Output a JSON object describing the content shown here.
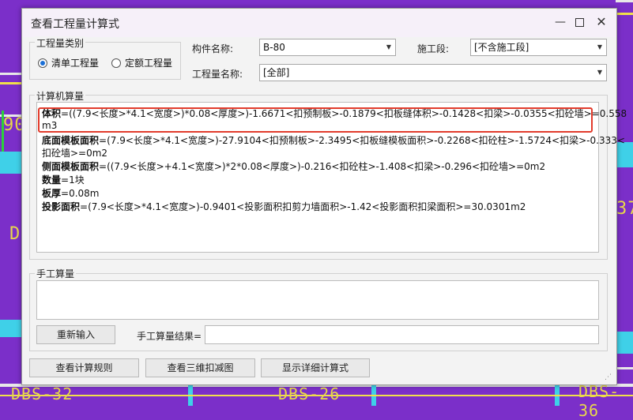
{
  "background": {
    "labels_bottom": [
      "DBS-32",
      "DBS-26",
      "DBS-36"
    ],
    "label_left": "90",
    "label_left2": "D",
    "label_right": "37"
  },
  "dialog": {
    "title": "查看工程量计算式",
    "controls": {
      "minimize": "—",
      "close": "✕"
    }
  },
  "quantity_type": {
    "group_label": "工程量类别",
    "options": [
      {
        "label": "清单工程量",
        "selected": true
      },
      {
        "label": "定额工程量",
        "selected": false
      }
    ]
  },
  "filters": {
    "component_label": "构件名称:",
    "component_value": "B-80",
    "section_label": "施工段:",
    "section_value": "[不含施工段]",
    "quantity_name_label": "工程量名称:",
    "quantity_name_value": "[全部]"
  },
  "computer_calc": {
    "group_label": "计算机算量",
    "lines": [
      {
        "term": "体积",
        "expr": "=((7.9<长度>*4.1<宽度>)*0.08<厚度>)-1.6671<扣预制板>-0.1879<扣板缝体积>-0.1428<扣梁>-0.0355<扣砼墙>=0.558"
      },
      {
        "term": "",
        "expr": "m3"
      },
      {
        "term": "底面模板面积",
        "expr": "=(7.9<长度>*4.1<宽度>)-27.9104<扣预制板>-2.3495<扣板缝模板面积>-0.2268<扣砼柱>-1.5724<扣梁>-0.333<"
      },
      {
        "term": "",
        "expr": "扣砼墙>=0m2"
      },
      {
        "term": "侧面模板面积",
        "expr": "=((7.9<长度>+4.1<宽度>)*2*0.08<厚度>)-0.216<扣砼柱>-1.408<扣梁>-0.296<扣砼墙>=0m2"
      },
      {
        "term": "数量",
        "expr": "=1块"
      },
      {
        "term": "板厚",
        "expr": "=0.08m"
      },
      {
        "term": "投影面积",
        "expr": "=(7.9<长度>*4.1<宽度>)-0.9401<投影面积扣剪力墙面积>-1.42<投影面积扣梁面积>=30.0301m2"
      }
    ]
  },
  "manual_calc": {
    "group_label": "手工算量",
    "reenter_button": "重新输入",
    "result_label": "手工算量结果="
  },
  "bottom_buttons": {
    "view_rules": "查看计算规则",
    "view_3d": "查看三维扣减图",
    "show_detail": "显示详细计算式"
  },
  "colors": {
    "background": "#7b2fc9",
    "highlight_border": "#e23b2c",
    "radio_accent": "#1a6fd6"
  }
}
